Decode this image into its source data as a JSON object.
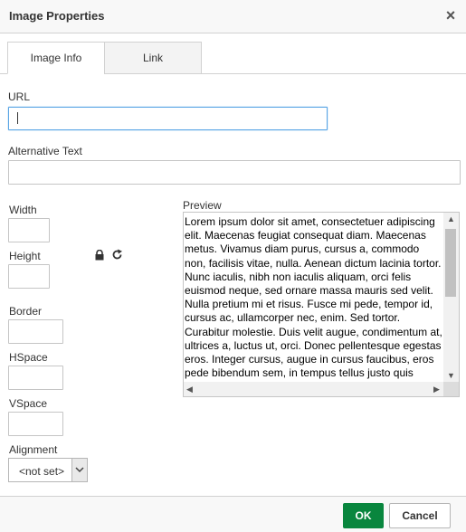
{
  "dialog": {
    "title": "Image Properties"
  },
  "tabs": [
    {
      "label": "Image Info",
      "active": true
    },
    {
      "label": "Link",
      "active": false
    }
  ],
  "fields": {
    "url_label": "URL",
    "url_value": "",
    "alt_label": "Alternative Text",
    "alt_value": "",
    "width_label": "Width",
    "height_label": "Height",
    "border_label": "Border",
    "hspace_label": "HSpace",
    "vspace_label": "VSpace",
    "alignment_label": "Alignment",
    "alignment_value": "<not set>"
  },
  "preview": {
    "label": "Preview",
    "text": "Lorem ipsum dolor sit amet, consectetuer adipiscing elit. Maecenas feugiat consequat diam. Maecenas metus. Vivamus diam purus, cursus a, commodo non, facilisis vitae, nulla. Aenean dictum lacinia tortor. Nunc iaculis, nibh non iaculis aliquam, orci felis euismod neque, sed ornare massa mauris sed velit. Nulla pretium mi et risus. Fusce mi pede, tempor id, cursus ac, ullamcorper nec, enim. Sed tortor. Curabitur molestie. Duis velit augue, condimentum at, ultrices a, luctus ut, orci. Donec pellentesque egestas eros. Integer cursus, augue in cursus faucibus, eros pede bibendum sem, in tempus tellus justo quis ligula. Etiam eget tortor."
  },
  "icons": {
    "lock": "lock-icon",
    "reset": "reset-size-icon",
    "close": "close-icon"
  },
  "footer": {
    "ok_label": "OK",
    "cancel_label": "Cancel"
  },
  "colors": {
    "ok_button": "#09863e",
    "focus_border": "#59a5e5"
  }
}
